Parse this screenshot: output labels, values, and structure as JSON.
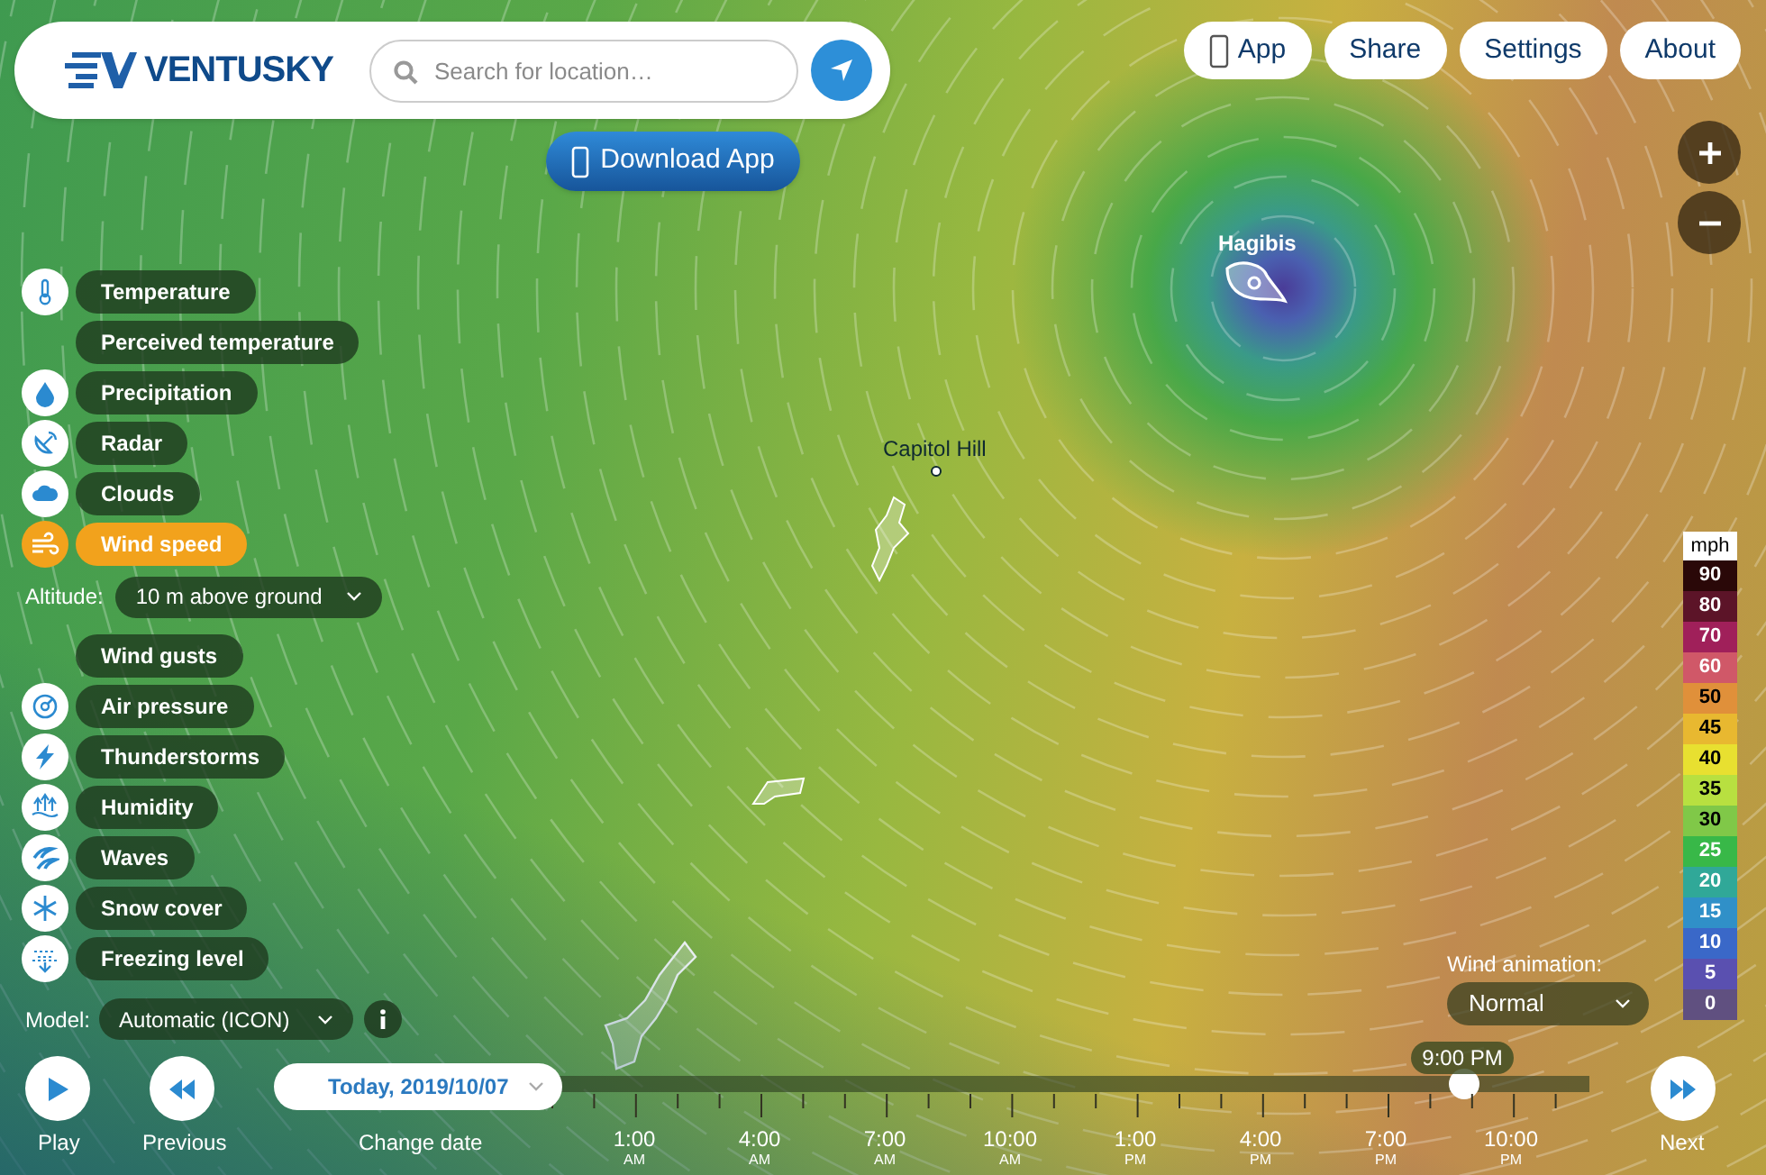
{
  "header": {
    "logo": "VENTUSKY",
    "search": {
      "placeholder": "Search for location…"
    }
  },
  "download_button": "Download App",
  "top_nav": [
    {
      "kind": "app",
      "label": "App"
    },
    {
      "kind": "plain",
      "label": "Share"
    },
    {
      "kind": "plain",
      "label": "Settings"
    },
    {
      "kind": "plain",
      "label": "About"
    }
  ],
  "map_labels": [
    {
      "kind": "storm",
      "text": "Hagibis"
    },
    {
      "kind": "place",
      "text": "Capitol Hill"
    }
  ],
  "layers": [
    {
      "label": "Temperature",
      "kind": "thermometer",
      "selected": false
    },
    {
      "label": "Perceived temperature",
      "selected": false
    },
    {
      "label": "Precipitation",
      "kind": "drop",
      "selected": false
    },
    {
      "label": "Radar",
      "kind": "radar",
      "selected": false
    },
    {
      "label": "Clouds",
      "kind": "cloud",
      "selected": false
    },
    {
      "label": "Wind speed",
      "kind": "wind",
      "selected": true,
      "altitude": {
        "label": "Altitude:",
        "value": "10 m above ground"
      }
    },
    {
      "label": "Wind gusts",
      "selected": false
    },
    {
      "label": "Air pressure",
      "kind": "pressure",
      "selected": false
    },
    {
      "label": "Thunderstorms",
      "kind": "bolt",
      "selected": false
    },
    {
      "label": "Humidity",
      "kind": "humidity",
      "selected": false
    },
    {
      "label": "Waves",
      "kind": "waves",
      "selected": false
    },
    {
      "label": "Snow cover",
      "kind": "snow",
      "selected": false
    },
    {
      "label": "Freezing level",
      "kind": "freezing",
      "selected": false
    }
  ],
  "model": {
    "label": "Model:",
    "value": "Automatic (ICON)"
  },
  "player": {
    "play": "Play",
    "previous": "Previous",
    "date": "Today, 2019/10/07",
    "change_date": "Change date",
    "next": "Next",
    "current_time": "9:00 PM",
    "level": 0.88,
    "time_marks": [
      {
        "time": "1:00",
        "period": "AM"
      },
      {
        "time": "4:00",
        "period": "AM"
      },
      {
        "time": "7:00",
        "period": "AM"
      },
      {
        "time": "10:00",
        "period": "AM"
      },
      {
        "time": "1:00",
        "period": "PM"
      },
      {
        "time": "4:00",
        "period": "PM"
      },
      {
        "time": "7:00",
        "period": "PM"
      },
      {
        "time": "10:00",
        "period": "PM"
      }
    ]
  },
  "wind_animation": {
    "label": "Wind animation:",
    "value": "Normal"
  },
  "legend": {
    "unit": "mph",
    "steps": [
      {
        "label": "90",
        "color": "#2a0808"
      },
      {
        "label": "80",
        "color": "#5c1428"
      },
      {
        "label": "70",
        "color": "#a0205a"
      },
      {
        "label": "60",
        "color": "#d05868"
      },
      {
        "label": "50",
        "color": "#e0903a"
      },
      {
        "label": "45",
        "color": "#e8b830"
      },
      {
        "label": "40",
        "color": "#e8e030"
      },
      {
        "label": "35",
        "color": "#b8e040"
      },
      {
        "label": "30",
        "color": "#80c848"
      },
      {
        "label": "25",
        "color": "#38b848"
      },
      {
        "label": "20",
        "color": "#30a898"
      },
      {
        "label": "15",
        "color": "#3090c8"
      },
      {
        "label": "10",
        "color": "#3a68c8"
      },
      {
        "label": "5",
        "color": "#5a50b0"
      },
      {
        "label": "0",
        "color": "#605080"
      }
    ]
  }
}
